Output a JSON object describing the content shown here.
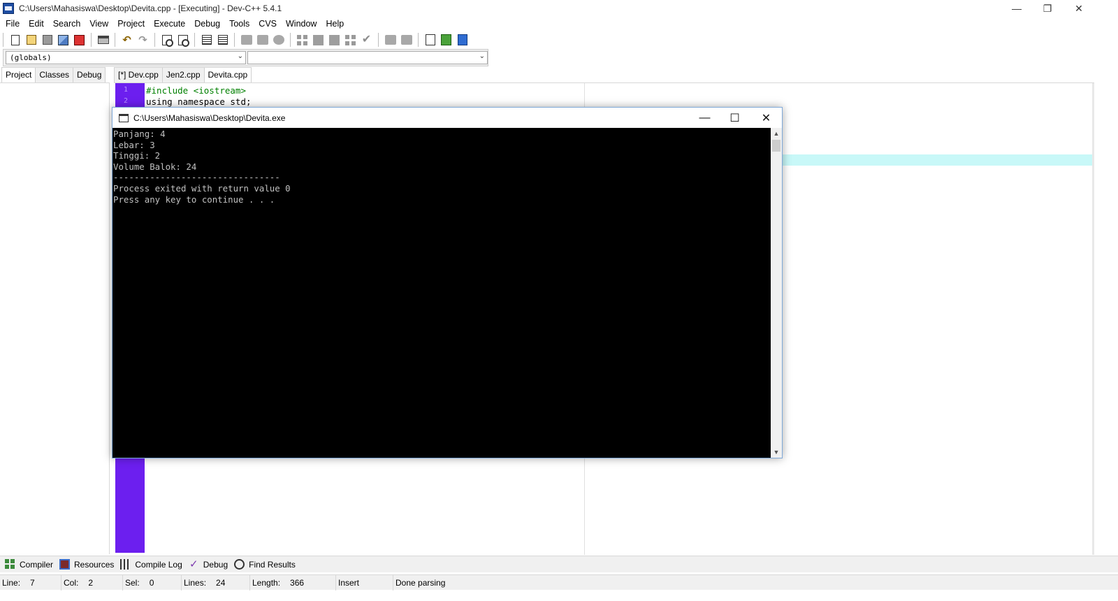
{
  "window": {
    "title": "C:\\Users\\Mahasiswa\\Desktop\\Devita.cpp - [Executing] - Dev-C++ 5.4.1",
    "minimize": "—",
    "restore": "❐",
    "close": "✕"
  },
  "menu": [
    "File",
    "Edit",
    "Search",
    "View",
    "Project",
    "Execute",
    "Debug",
    "Tools",
    "CVS",
    "Window",
    "Help"
  ],
  "scope": {
    "left_value": "(globals)",
    "right_value": ""
  },
  "left_tabs": [
    "Project",
    "Classes",
    "Debug"
  ],
  "editor_tabs": [
    "[*] Dev.cpp",
    "Jen2.cpp",
    "Devita.cpp"
  ],
  "editor": {
    "lines": [
      {
        "num": "1",
        "text": "#include <iostream>",
        "color": "#008000"
      },
      {
        "num": "2",
        "text": "using namespace std;",
        "color": "#000000"
      }
    ],
    "gutter_color": "#6c1fef",
    "highlight_color": "#c8f8f8"
  },
  "console": {
    "title": "C:\\Users\\Mahasiswa\\Desktop\\Devita.exe",
    "lines": [
      "Panjang: 4",
      "Lebar: 3",
      "Tinggi: 2",
      "Volume Balok: 24",
      "--------------------------------",
      "Process exited with return value 0",
      "Press any key to continue . . ."
    ],
    "controls": {
      "minimize": "—",
      "maximize": "☐",
      "close": "✕"
    }
  },
  "bottom_tabs": [
    {
      "label": "Compiler",
      "icon": "compiler-icon"
    },
    {
      "label": "Resources",
      "icon": "resources-icon"
    },
    {
      "label": "Compile Log",
      "icon": "compile-log-icon"
    },
    {
      "label": "Debug",
      "icon": "debug-icon"
    },
    {
      "label": "Find Results",
      "icon": "find-results-icon"
    }
  ],
  "status": {
    "line_label": "Line:",
    "line_value": "7",
    "col_label": "Col:",
    "col_value": "2",
    "sel_label": "Sel:",
    "sel_value": "0",
    "lines_label": "Lines:",
    "lines_value": "24",
    "length_label": "Length:",
    "length_value": "366",
    "mode": "Insert",
    "message": "Done parsing"
  }
}
